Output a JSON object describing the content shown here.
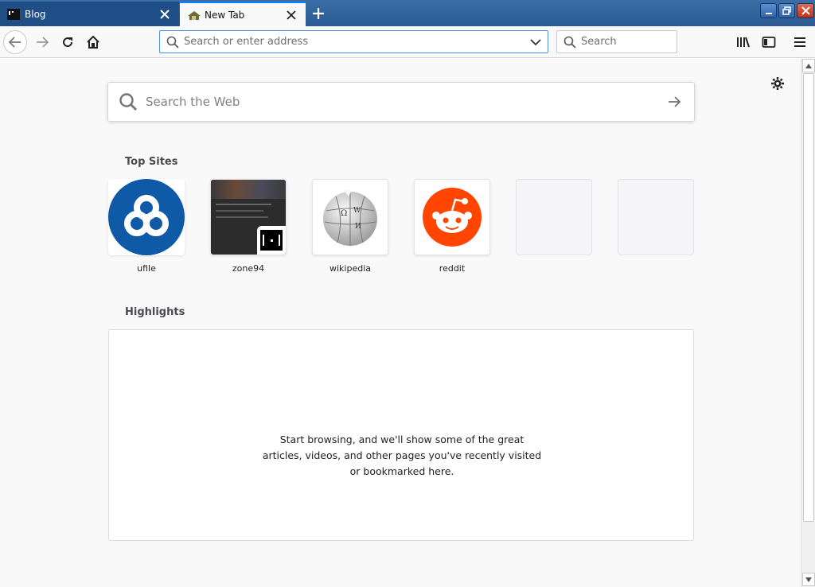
{
  "tabs": [
    {
      "title": "Blog",
      "favicon": "terminal-favicon",
      "active": false
    },
    {
      "title": "New Tab",
      "favicon": "newtab-favicon",
      "active": true
    }
  ],
  "navbar": {
    "url_placeholder": "Search or enter address",
    "search_placeholder": "Search"
  },
  "newtab": {
    "web_search_placeholder": "Search the Web",
    "top_sites_title": "Top Sites",
    "top_sites": [
      {
        "label": "ufile",
        "color": "#0e5aa6"
      },
      {
        "label": "zone94"
      },
      {
        "label": "wikipedia"
      },
      {
        "label": "reddit",
        "color": "#ff4500"
      },
      {
        "label": ""
      },
      {
        "label": ""
      }
    ],
    "highlights_title": "Highlights",
    "highlights_message": "Start browsing, and we'll show some of the great articles, videos, and other pages you've recently visited or bookmarked here."
  },
  "colors": {
    "accent": "#0a84ff",
    "titlebar": "#2a5a94"
  }
}
